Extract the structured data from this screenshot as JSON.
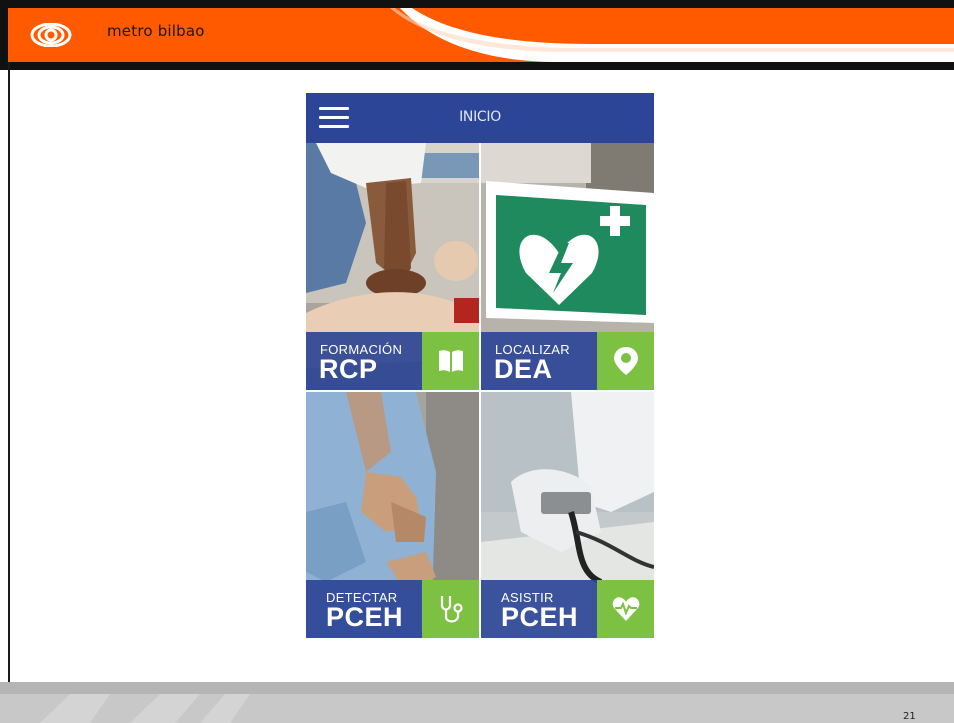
{
  "header": {
    "brand_name": "metro bilbao",
    "logo_icon": "metro-bilbao-logo-icon",
    "accent_color": "#ff5a00"
  },
  "app": {
    "title": "INICIO",
    "menu_icon": "hamburger-menu-icon",
    "bar_color": "#2c4596",
    "icon_bg_color": "#7dc142",
    "tiles": [
      {
        "small": "FORMACIÓN",
        "big": "RCP",
        "icon": "book-icon"
      },
      {
        "small": "LOCALIZAR",
        "big": "DEA",
        "icon": "location-pin-icon"
      },
      {
        "small": "DETECTAR",
        "big": "PCEH",
        "icon": "stethoscope-icon"
      },
      {
        "small": "ASISTIR",
        "big": "PCEH",
        "icon": "heartbeat-icon"
      }
    ]
  },
  "footer": {
    "page_number": "21"
  }
}
